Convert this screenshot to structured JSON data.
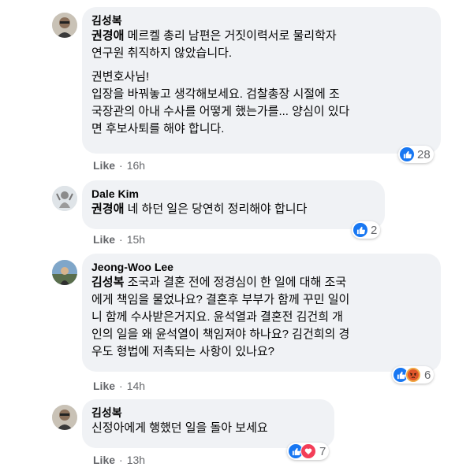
{
  "comments": [
    {
      "author": "김성복",
      "mention": "권경애",
      "text1": " 메르켈 총리 남편은 거짓이력서로 물리학자\n연구원 취직하지 않았습니다.",
      "text2": "권변호사님!\n입장을 바꿔놓고 생각해보세요. 검찰총장 시절에 조\n국장관의 아내 수사를 어떻게 했는가를... 양심이 있다\n면 후보사퇴를 해야 합니다.",
      "reaction_count": "28",
      "like_label": "Like",
      "time": "16h"
    },
    {
      "author": "Dale Kim",
      "mention": "권경애",
      "text1": " 네 하던 일은 당연히 정리해야 합니다",
      "reaction_count": "2",
      "like_label": "Like",
      "time": "15h"
    },
    {
      "author": "Jeong-Woo Lee",
      "mention": "김성복",
      "text1": " 조국과 결혼 전에 정경심이 한 일에 대해 조국\n에게 책임을 물었나요? 결혼후 부부가 함께 꾸민 일이\n니 함께 수사받은거지요. 윤석열과 결혼전 김건희 개\n인의 일을 왜 윤석열이 책임져야 하나요? 김건희의 경\n우도 형법에 저촉되는 사항이 있나요?",
      "reaction_count": "6",
      "like_label": "Like",
      "time": "14h"
    },
    {
      "author": "김성복",
      "text1": "신정아에게 행했던 일을 돌아 보세요",
      "reaction_count": "7",
      "like_label": "Like",
      "time": "13h"
    }
  ],
  "separator": "·",
  "colors": {
    "bubble": "#f0f2f5",
    "like_blue": "#1877f2",
    "meta_gray": "#65676b",
    "love_red": "#f33e58",
    "angry_orange": "#f0a742"
  },
  "icons": [
    "like-reaction-icon",
    "angry-reaction-icon",
    "love-reaction-icon"
  ]
}
